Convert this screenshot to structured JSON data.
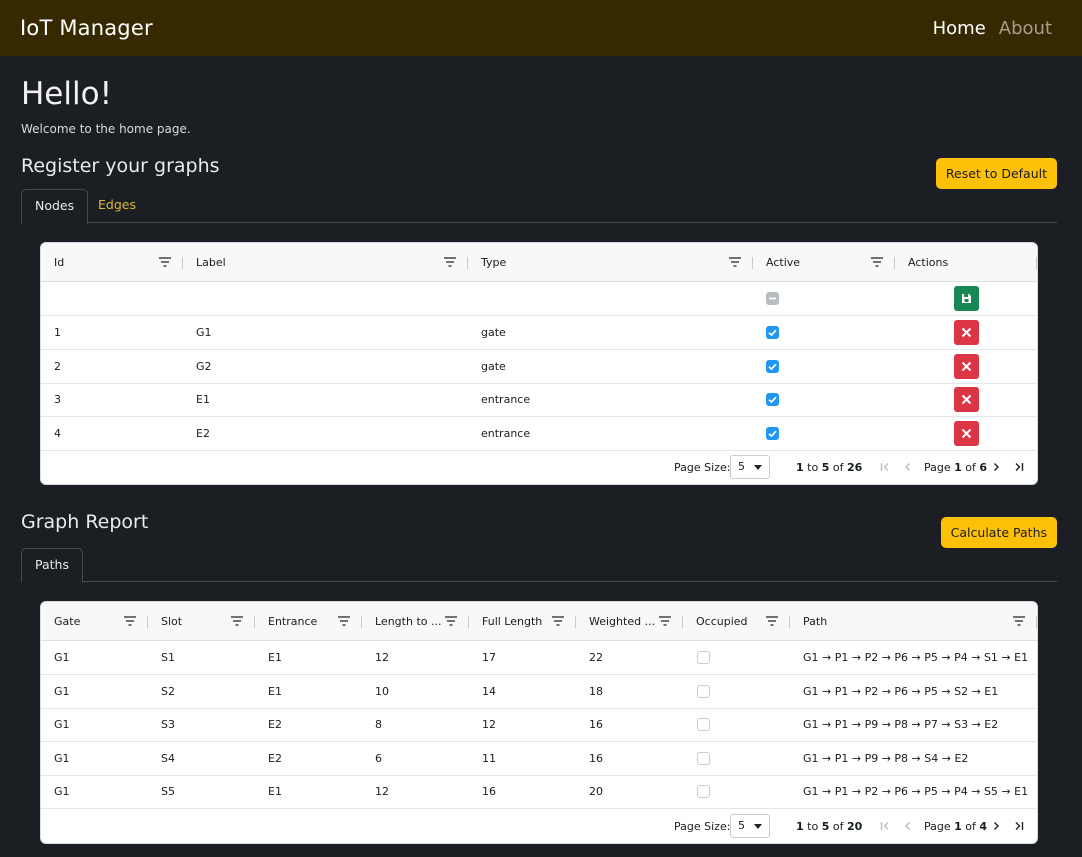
{
  "navbar": {
    "brand": "IoT Manager",
    "links": [
      {
        "label": "Home",
        "active": true
      },
      {
        "label": "About",
        "active": false
      }
    ]
  },
  "home": {
    "title": "Hello!",
    "subtitle": "Welcome to the home page."
  },
  "register": {
    "title": "Register your graphs",
    "reset_label": "Reset to Default",
    "tabs": [
      "Nodes",
      "Edges"
    ],
    "active_tab": "Nodes"
  },
  "nodes_grid": {
    "columns": [
      "Id",
      "Label",
      "Type",
      "Active",
      "Actions"
    ],
    "new_row": {
      "active": "indeterminate",
      "action": "save"
    },
    "rows": [
      {
        "id": "1",
        "label": "G1",
        "type": "gate",
        "active": true
      },
      {
        "id": "2",
        "label": "G2",
        "type": "gate",
        "active": true
      },
      {
        "id": "3",
        "label": "E1",
        "type": "entrance",
        "active": true
      },
      {
        "id": "4",
        "label": "E2",
        "type": "entrance",
        "active": true
      }
    ],
    "pager": {
      "page_size_label": "Page Size:",
      "page_size": "5",
      "from": "1",
      "to_word": "to",
      "to": "5",
      "of_word": "of",
      "total": "26",
      "page_word": "Page",
      "page": "1",
      "pages": "6"
    }
  },
  "report": {
    "title": "Graph Report",
    "calc_label": "Calculate Paths",
    "tabs": [
      "Paths"
    ],
    "active_tab": "Paths"
  },
  "paths_grid": {
    "columns": [
      "Gate",
      "Slot",
      "Entrance",
      "Length to ...",
      "Full Length",
      "Weighted ...",
      "Occupied",
      "Path"
    ],
    "rows": [
      {
        "gate": "G1",
        "slot": "S1",
        "entrance": "E1",
        "length_to": "12",
        "full_length": "17",
        "weighted": "22",
        "occupied": false,
        "path": "G1 → P1 → P2 → P6 → P5 → P4 → S1 → E1"
      },
      {
        "gate": "G1",
        "slot": "S2",
        "entrance": "E1",
        "length_to": "10",
        "full_length": "14",
        "weighted": "18",
        "occupied": false,
        "path": "G1 → P1 → P2 → P6 → P5 → S2 → E1"
      },
      {
        "gate": "G1",
        "slot": "S3",
        "entrance": "E2",
        "length_to": "8",
        "full_length": "12",
        "weighted": "16",
        "occupied": false,
        "path": "G1 → P1 → P9 → P8 → P7 → S3 → E2"
      },
      {
        "gate": "G1",
        "slot": "S4",
        "entrance": "E2",
        "length_to": "6",
        "full_length": "11",
        "weighted": "16",
        "occupied": false,
        "path": "G1 → P1 → P9 → P8 → S4 → E2"
      },
      {
        "gate": "G1",
        "slot": "S5",
        "entrance": "E1",
        "length_to": "12",
        "full_length": "16",
        "weighted": "20",
        "occupied": false,
        "path": "G1 → P1 → P2 → P6 → P5 → P4 → S5 → E1"
      }
    ],
    "pager": {
      "page_size_label": "Page Size:",
      "page_size": "5",
      "from": "1",
      "to_word": "to",
      "to": "5",
      "of_word": "of",
      "total": "20",
      "page_word": "Page",
      "page": "1",
      "pages": "4"
    }
  },
  "colors": {
    "navbar": "#362900",
    "background": "#1b1f23",
    "warning": "#ffc107",
    "checkbox": "#2196f3",
    "save": "#198754",
    "delete": "#dc3545"
  },
  "icons": [
    "filter-icon",
    "save-icon",
    "delete-icon",
    "first-page-icon",
    "prev-page-icon",
    "next-page-icon",
    "last-page-icon",
    "caret-down-icon"
  ]
}
